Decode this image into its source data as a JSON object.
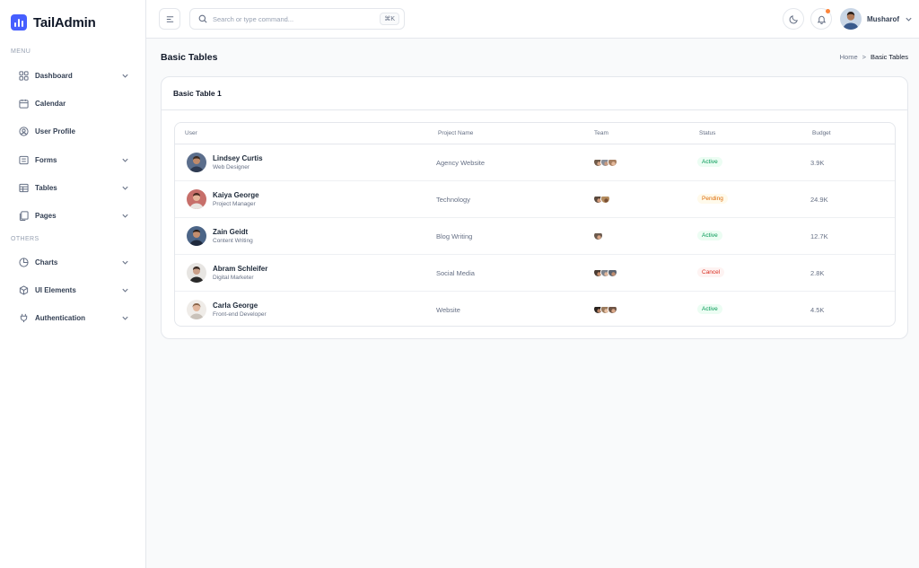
{
  "app": {
    "name": "TailAdmin",
    "accent": "#465fff"
  },
  "sidebar": {
    "menu_label": "MENU",
    "others_label": "OTHERS",
    "menu_items": [
      {
        "label": "Dashboard",
        "icon": "grid-icon",
        "has_submenu": true
      },
      {
        "label": "Calendar",
        "icon": "calendar-icon",
        "has_submenu": false
      },
      {
        "label": "User Profile",
        "icon": "user-circle-icon",
        "has_submenu": false
      },
      {
        "label": "Forms",
        "icon": "list-icon",
        "has_submenu": true
      },
      {
        "label": "Tables",
        "icon": "table-icon",
        "has_submenu": true
      },
      {
        "label": "Pages",
        "icon": "pages-icon",
        "has_submenu": true
      }
    ],
    "other_items": [
      {
        "label": "Charts",
        "icon": "pie-chart-icon",
        "has_submenu": true
      },
      {
        "label": "UI Elements",
        "icon": "box-icon",
        "has_submenu": true
      },
      {
        "label": "Authentication",
        "icon": "plug-icon",
        "has_submenu": true
      }
    ]
  },
  "header": {
    "search_placeholder": "Search or type command...",
    "search_shortcut": "⌘K",
    "user_name": "Musharof"
  },
  "page": {
    "title": "Basic Tables",
    "breadcrumb": {
      "home": "Home",
      "separator": ">",
      "current": "Basic Tables"
    }
  },
  "card": {
    "title": "Basic Table 1",
    "columns": [
      "User",
      "Project Name",
      "Team",
      "Status",
      "Budget"
    ],
    "rows": [
      {
        "name": "Lindsey Curtis",
        "role": "Web Designer",
        "project": "Agency Website",
        "team_size": 3,
        "status": "Active",
        "status_type": "active",
        "budget": "3.9K"
      },
      {
        "name": "Kaiya George",
        "role": "Project Manager",
        "project": "Technology",
        "team_size": 2,
        "status": "Pending",
        "status_type": "pending",
        "budget": "24.9K"
      },
      {
        "name": "Zain Geidt",
        "role": "Content Writing",
        "project": "Blog Writing",
        "team_size": 1,
        "status": "Active",
        "status_type": "active",
        "budget": "12.7K"
      },
      {
        "name": "Abram Schleifer",
        "role": "Digital Marketer",
        "project": "Social Media",
        "team_size": 3,
        "status": "Cancel",
        "status_type": "cancel",
        "budget": "2.8K"
      },
      {
        "name": "Carla George",
        "role": "Front-end Developer",
        "project": "Website",
        "team_size": 3,
        "status": "Active",
        "status_type": "active",
        "budget": "4.5K"
      }
    ]
  },
  "colors": {
    "active": "#039855",
    "pending": "#dc6803",
    "cancel": "#d92d20",
    "notification_dot": "#fd853a"
  }
}
